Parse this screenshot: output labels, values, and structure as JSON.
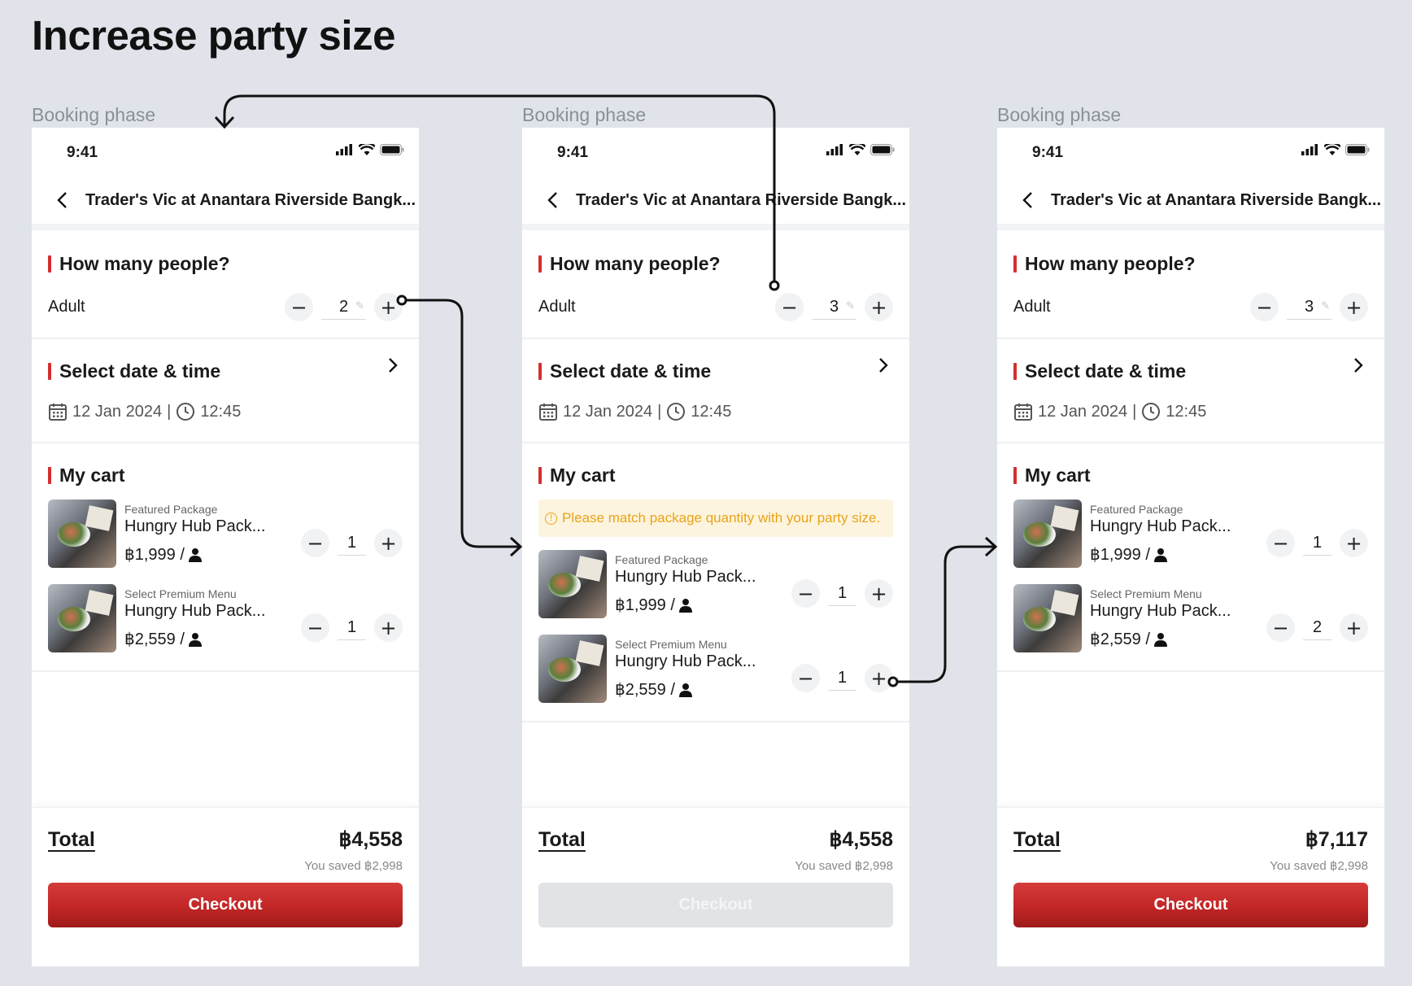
{
  "title": "Increase party size",
  "phase_label": "Booking phase",
  "status_time": "9:41",
  "restaurant_name": "Trader's Vic at Anantara Riverside Bangk...",
  "people_heading": "How many people?",
  "adult_label": "Adult",
  "datetime_heading": "Select date & time",
  "date": "12 Jan 2024",
  "time": "12:45",
  "cart_heading": "My cart",
  "warning_text": "Please match package quantity with your party size.",
  "total_label": "Total",
  "checkout_label": "Checkout",
  "items": {
    "featured": {
      "category": "Featured Package",
      "name": "Hungry Hub Pack...",
      "price": "฿1,999 /"
    },
    "premium": {
      "category": "Select Premium Menu",
      "name": "Hungry Hub Pack...",
      "price": "฿2,559 /"
    }
  },
  "screens": [
    {
      "adult_count": "2",
      "featured_qty": "1",
      "premium_qty": "1",
      "total": "฿4,558",
      "saved": "You saved ฿2,998",
      "checkout_enabled": true
    },
    {
      "adult_count": "3",
      "featured_qty": "1",
      "premium_qty": "1",
      "total": "฿4,558",
      "saved": "You saved ฿2,998",
      "checkout_enabled": false
    },
    {
      "adult_count": "3",
      "featured_qty": "1",
      "premium_qty": "2",
      "total": "฿7,117",
      "saved": "You saved ฿2,998",
      "checkout_enabled": true
    }
  ],
  "icons": [
    "signal-icon",
    "wifi-icon",
    "battery-icon",
    "back-icon",
    "chevron-right-icon",
    "calendar-icon",
    "clock-icon",
    "person-icon",
    "pencil-icon",
    "minus-icon",
    "plus-icon",
    "warning-icon"
  ],
  "colors": {
    "accent": "#d32f2f",
    "warning_bg": "#fdf4df",
    "warning_text": "#e8a417",
    "page_bg": "#e0e4ea"
  }
}
